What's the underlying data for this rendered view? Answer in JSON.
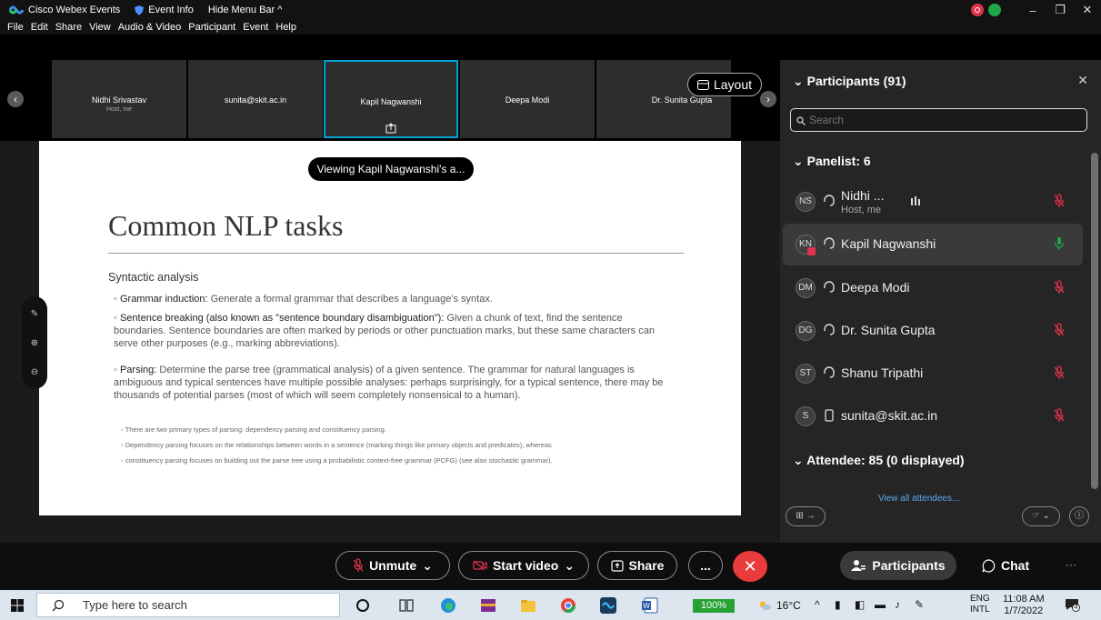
{
  "titlebar": {
    "app_name": "Cisco Webex Events",
    "event_info": "Event Info",
    "hide_menu": "Hide Menu Bar ^"
  },
  "menu": [
    "File",
    "Edit",
    "Share",
    "View",
    "Audio & Video",
    "Participant",
    "Event",
    "Help"
  ],
  "filmstrip": {
    "tiles": [
      {
        "name": "Nidhi Srivastav",
        "sub": "Host, me"
      },
      {
        "name": "sunita@skit.ac.in",
        "sub": ""
      },
      {
        "name": "Kapil Nagwanshi",
        "sub": ""
      },
      {
        "name": "Deepa Modi",
        "sub": ""
      },
      {
        "name": "Dr. Sunita Gupta",
        "sub": ""
      }
    ],
    "layout_label": "Layout"
  },
  "stage": {
    "viewing": "Viewing Kapil Nagwanshi's a...",
    "slide": {
      "title": "Common NLP tasks",
      "section": "Syntactic analysis",
      "bullets": [
        {
          "term": "Grammar induction:",
          "text": " Generate a formal grammar that describes a language's syntax."
        },
        {
          "term": "Sentence breaking (also known as \"sentence boundary disambiguation\"):",
          "text": " Given a chunk of text, find the sentence boundaries. Sentence boundaries are often marked by periods or other punctuation marks, but these same characters can serve other purposes (e.g., marking abbreviations)."
        },
        {
          "term": "Parsing:",
          "text": " Determine the parse tree (grammatical analysis) of a given sentence. The grammar for natural languages is ambiguous and typical sentences have multiple possible analyses: perhaps surprisingly, for a typical sentence, there may be thousands of potential parses (most of which will seem completely nonsensical to a human)."
        }
      ],
      "subbullets": [
        "There are two primary types of parsing: dependency parsing and constituency parsing.",
        "Dependency parsing focuses on the relationships between words in a sentence (marking things like primary objects and predicates), whereas",
        "constituency parsing focuses on building out the parse tree using a probabilistic context-free grammar (PCFG) (see also stochastic grammar)."
      ]
    }
  },
  "panel": {
    "title": "Participants (91)",
    "search_placeholder": "Search",
    "panelist_label": "Panelist: 6",
    "panelists": [
      {
        "initials": "NS",
        "name": "Nidhi ...",
        "sub": "Host, me"
      },
      {
        "initials": "KN",
        "name": "Kapil Nagwanshi",
        "sub": ""
      },
      {
        "initials": "DM",
        "name": "Deepa Modi",
        "sub": ""
      },
      {
        "initials": "DG",
        "name": "Dr. Sunita Gupta",
        "sub": ""
      },
      {
        "initials": "ST",
        "name": "Shanu Tripathi",
        "sub": ""
      },
      {
        "initials": "S",
        "name": "sunita@skit.ac.in",
        "sub": ""
      }
    ],
    "attendee_label": "Attendee: 85 (0 displayed)",
    "view_all": "View all attendees..."
  },
  "controls": {
    "unmute": "Unmute",
    "start_video": "Start video",
    "share": "Share",
    "more": "...",
    "participants": "Participants",
    "chat": "Chat"
  },
  "taskbar": {
    "search_placeholder": "Type here to search",
    "battery": "100%",
    "temperature": "16°C",
    "lang1": "ENG",
    "lang2": "INTL",
    "time": "11:08 AM",
    "date": "1/7/2022",
    "notifications": "4"
  },
  "colors": {
    "accent": "#00a0d1",
    "end_call": "#e93b3b",
    "mic_muted": "#e0334b",
    "mic_active": "#1fa84a"
  }
}
